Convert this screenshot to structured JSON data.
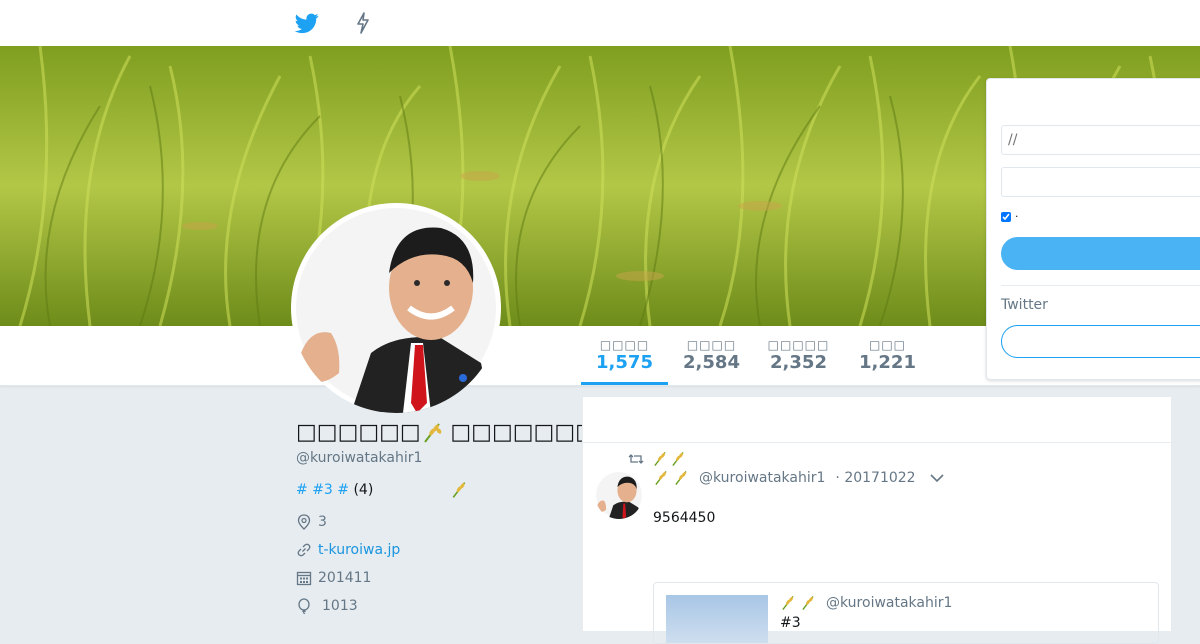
{
  "topbar": {
    "icons": [
      "twitter-bird-icon",
      "moments-lightning-icon"
    ]
  },
  "banner": {
    "description_icon": "rice-field-banner"
  },
  "profile": {
    "name": "□□□□□□",
    "name_suffix": "□□□□□□□□□□□",
    "handle": "@kuroiwatakahir1",
    "bio_tags": [
      "#",
      "#3",
      "#"
    ],
    "bio_count": "(4)",
    "location": "3",
    "website": "t-kuroiwa.jp",
    "joined": "201411",
    "birthday": "1013"
  },
  "stats": [
    {
      "label": "□□□□",
      "value": "1,575",
      "active": true
    },
    {
      "label": "□□□□",
      "value": "2,584",
      "active": false
    },
    {
      "label": "□□□□□",
      "value": "2,352",
      "active": false
    },
    {
      "label": "□□□",
      "value": "1,221",
      "active": false
    }
  ],
  "tweet": {
    "handle": "@kuroiwatakahir1",
    "date": "· 20171022",
    "text": "9564450",
    "quote": {
      "handle": "@kuroiwatakahir1",
      "text": "#3"
    }
  },
  "login": {
    "username_placeholder": "//",
    "password_placeholder": "",
    "remember_label": "·",
    "signup_prompt": "Twitter"
  },
  "colors": {
    "accent": "#1da1f2",
    "background": "#e6ecf0",
    "login_button": "#4ab3f4"
  }
}
